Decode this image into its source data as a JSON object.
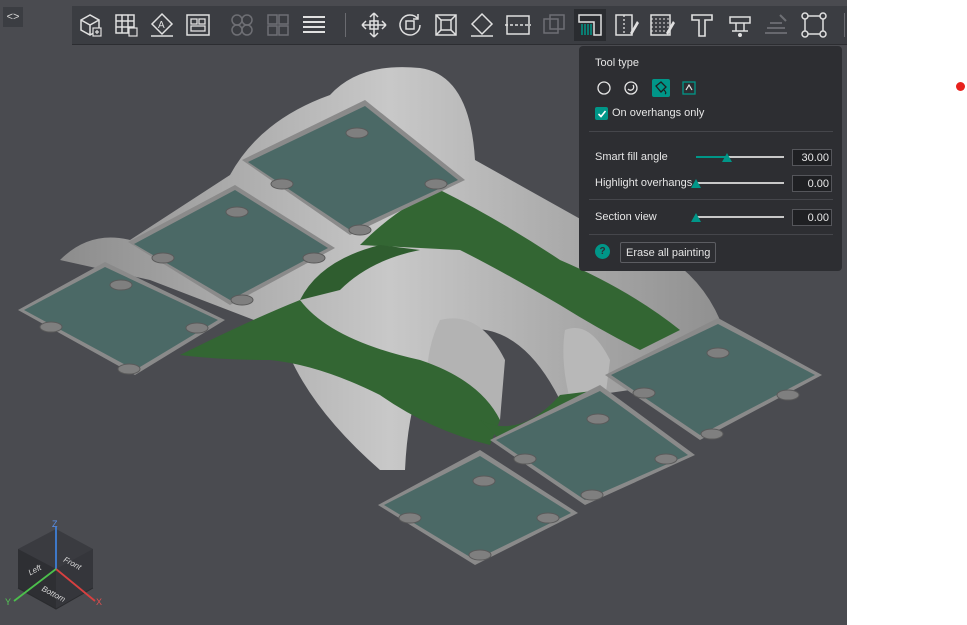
{
  "toolbar": {
    "buttons": [
      {
        "name": "add-cube-icon"
      },
      {
        "name": "arrange-grid-icon"
      },
      {
        "name": "orient-icon"
      },
      {
        "name": "auto-orient-icon"
      },
      {
        "name": "split-objects-icon"
      },
      {
        "name": "split-parts-icon"
      },
      {
        "name": "layers-icon"
      },
      {
        "name": "move-icon"
      },
      {
        "name": "rotate-icon"
      },
      {
        "name": "scale-icon"
      },
      {
        "name": "lay-on-face-icon"
      },
      {
        "name": "cut-icon"
      },
      {
        "name": "boolean-icon"
      },
      {
        "name": "support-painting-icon"
      },
      {
        "name": "seam-painting-icon"
      },
      {
        "name": "color-painting-icon"
      },
      {
        "name": "text-icon"
      },
      {
        "name": "measure-icon"
      },
      {
        "name": "assembly-icon"
      },
      {
        "name": "variable-layer-icon"
      }
    ]
  },
  "panel": {
    "tool_type_label": "Tool type",
    "tools": [
      {
        "name": "circle-tool-icon"
      },
      {
        "name": "sphere-tool-icon"
      },
      {
        "name": "fill-tool-icon",
        "selected": true
      },
      {
        "name": "gap-fill-tool-icon"
      }
    ],
    "overhangs_only_label": "On overhangs only",
    "overhangs_only_checked": true,
    "smart_fill_label": "Smart fill angle",
    "smart_fill_value": "30.00",
    "smart_fill_fraction": 0.35,
    "highlight_label": "Highlight overhangs",
    "highlight_value": "0.00",
    "highlight_fraction": 0.0,
    "section_label": "Section view",
    "section_value": "0.00",
    "section_fraction": 0.0,
    "help_symbol": "?",
    "erase_label": "Erase all painting"
  },
  "gizmo": {
    "axis_z": "Z",
    "axis_x": "X",
    "axis_y": "Y",
    "face_left": "Left",
    "face_front": "Front",
    "face_bottom": "Bottom"
  },
  "colors": {
    "accent": "#009688",
    "painted_support": "#336633",
    "plate": "#4b6966",
    "model": "#a9a9a9"
  }
}
